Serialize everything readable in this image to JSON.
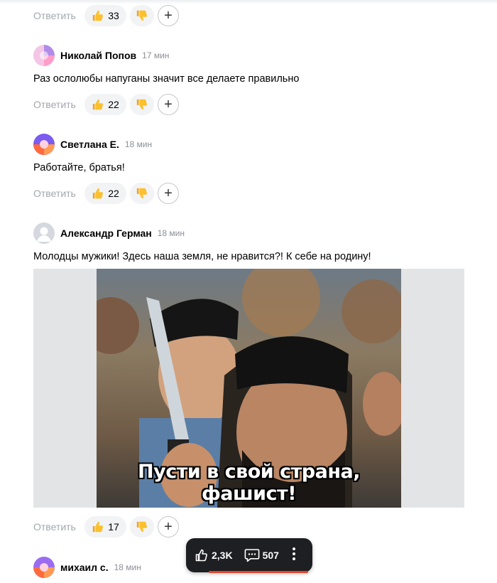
{
  "reply_label": "Ответить",
  "comments": [
    {
      "likes": "33"
    },
    {
      "author": "Николай Попов",
      "time": "17 мин",
      "text": "Раз ослолюбы напуганы значит все делаете правильно",
      "likes": "22"
    },
    {
      "author": "Светлана Е.",
      "time": "18 мин",
      "text": "Работайте, братья!",
      "likes": "22"
    },
    {
      "author": "Александр Герман",
      "time": "18 мин",
      "text": "Молодцы мужики! Здесь наша земля, не нравится?! К себе на родину!",
      "likes": "17",
      "image_caption": "Пусти в свой страна, фашист!"
    },
    {
      "author": "михаил с.",
      "time": "18 мин"
    }
  ],
  "floating_bar": {
    "likes": "2,3K",
    "comments": "507"
  },
  "colors": {
    "accent": "#e8432c",
    "pill_bg": "#f2f3f5",
    "bar_bg": "#1e1f22"
  }
}
